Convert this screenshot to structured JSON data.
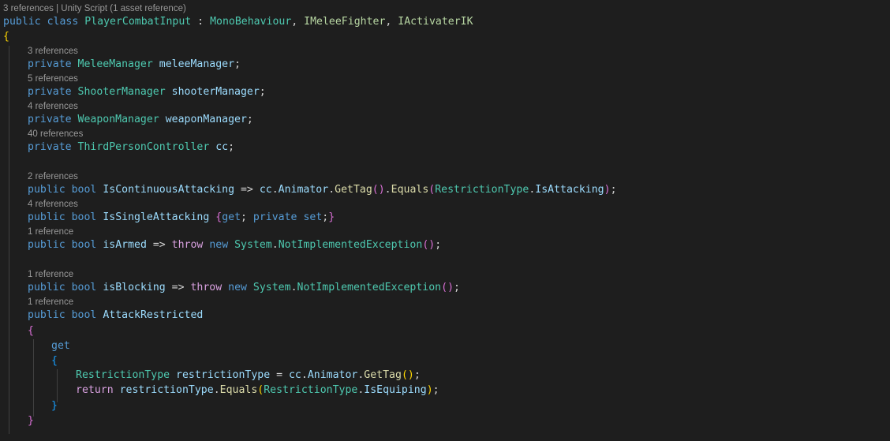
{
  "code_lens": {
    "class": "3 references | Unity Script (1 asset reference)",
    "melee": "3 references",
    "shooter": "5 references",
    "weapon": "4 references",
    "cc": "40 references",
    "continuous": "2 references",
    "single": "4 references",
    "armed": "1 reference",
    "blocking": "1 reference",
    "restricted": "1 reference"
  },
  "tokens": {
    "public": "public",
    "private": "private",
    "class": "class",
    "bool": "bool",
    "get": "get",
    "set": "set",
    "throw": "throw",
    "new": "new",
    "return": "return",
    "PlayerCombatInput": "PlayerCombatInput",
    "MonoBehaviour": "MonoBehaviour",
    "IMeleeFighter": "IMeleeFighter",
    "IActivaterIK": "IActivaterIK",
    "MeleeManager": "MeleeManager",
    "meleeManager": "meleeManager",
    "ShooterManager": "ShooterManager",
    "shooterManager": "shooterManager",
    "WeaponManager": "WeaponManager",
    "weaponManager": "weaponManager",
    "ThirdPersonController": "ThirdPersonController",
    "cc": "cc",
    "IsContinuousAttacking": "IsContinuousAttacking",
    "Animator": "Animator",
    "GetTag": "GetTag",
    "Equals": "Equals",
    "RestrictionType": "RestrictionType",
    "IsAttacking": "IsAttacking",
    "IsSingleAttacking": "IsSingleAttacking",
    "isArmed": "isArmed",
    "System": "System",
    "NotImplementedException": "NotImplementedException",
    "isBlocking": "isBlocking",
    "AttackRestricted": "AttackRestricted",
    "restrictionType": "restrictionType",
    "IsEquiping": "IsEquiping"
  },
  "colors": {
    "background": "#1e1e1e",
    "keyword": "#569cd6",
    "control_keyword": "#d8a0df",
    "type": "#4ec9b0",
    "interface": "#b8d7a3",
    "variable": "#9cdcfe",
    "method": "#dcdcaa",
    "bracket_level_1": "#ffd700",
    "bracket_level_2": "#da70d6",
    "bracket_level_3": "#179fff",
    "code_lens": "#999999"
  }
}
